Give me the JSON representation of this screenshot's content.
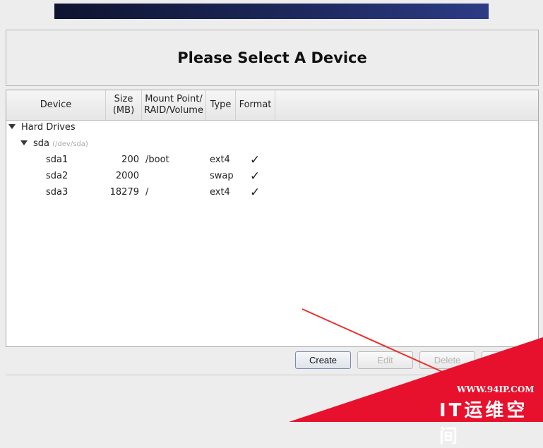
{
  "header": {
    "title": "Please Select A Device"
  },
  "columns": [
    "Device",
    "Size\n(MB)",
    "Mount Point/\nRAID/Volume",
    "Type",
    "Format"
  ],
  "tree": {
    "group": "Hard Drives",
    "disk": {
      "name": "sda",
      "path": "(/dev/sda)"
    },
    "partitions": [
      {
        "device": "sda1",
        "size": "200",
        "mount": "/boot",
        "type": "ext4",
        "format": "✓"
      },
      {
        "device": "sda2",
        "size": "2000",
        "mount": "",
        "type": "swap",
        "format": "✓"
      },
      {
        "device": "sda3",
        "size": "18279",
        "mount": "/",
        "type": "ext4",
        "format": "✓"
      }
    ]
  },
  "buttons": {
    "create": "Create",
    "edit": "Edit",
    "delete": "Delete",
    "reset": "Reset"
  },
  "watermark": {
    "url": "WWW.94IP.COM",
    "name": "IT运维空间"
  },
  "colors": {
    "watermark": "#e8112d",
    "annotation_arrow": "#e8302d"
  }
}
